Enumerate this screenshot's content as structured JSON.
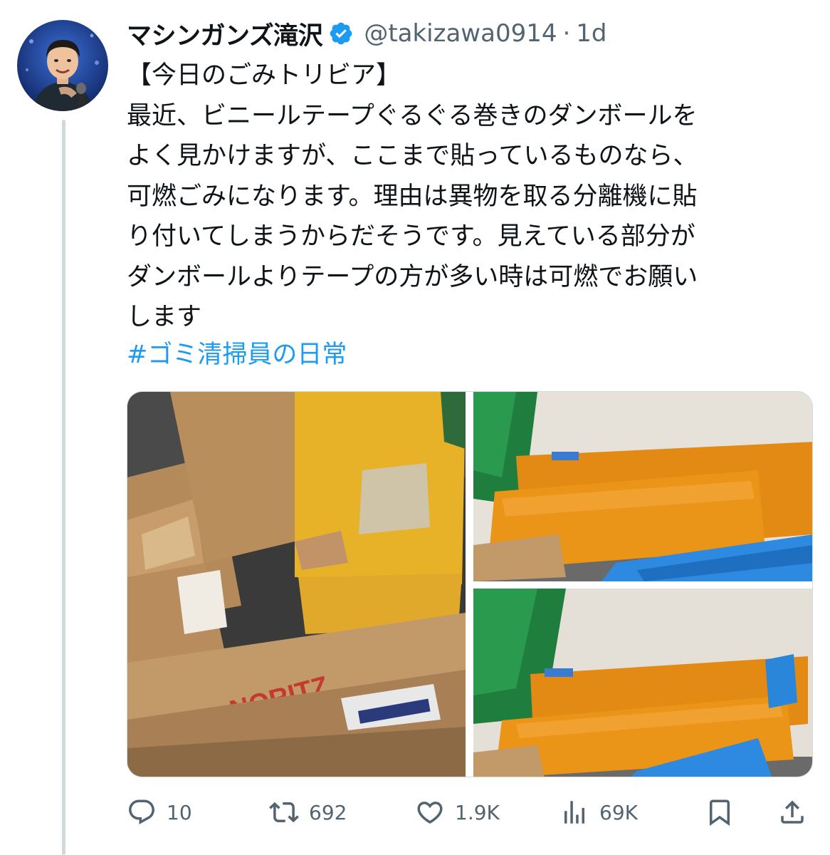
{
  "tweet": {
    "author": {
      "display_name": "マシンガンズ滝沢",
      "handle": "@takizawa0914",
      "separator": "·",
      "time": "1d",
      "verified": true,
      "verified_color": "#1d9bf0"
    },
    "text_lines": [
      "【今日のごみトリビア】",
      "最近、ビニールテープぐるぐる巻きのダンボールを",
      "よく見かけますが、ここまで貼っているものなら、",
      "可燃ごみになります。理由は異物を取る分離機に貼",
      "り付いてしまうからだそうです。見えている部分が",
      "ダンボールよりテープの方が多い時は可燃でお願い",
      "します"
    ],
    "hashtag": "#ゴミ清掃員の日常",
    "images": [
      {
        "alt": "Cardboard boxes wrapped in yellow tape with NORITZ box"
      },
      {
        "alt": "Cardboard wrapped in orange tape leaning on wall"
      },
      {
        "alt": "Cardboard wrapped in orange tape next to blue crate"
      }
    ],
    "image_text": {
      "brand": "NORITZ"
    },
    "actions": {
      "replies": "10",
      "retweets": "692",
      "likes": "1.9K",
      "views": "69K"
    },
    "icons": [
      "reply-icon",
      "retweet-icon",
      "like-icon",
      "views-icon",
      "bookmark-icon",
      "share-icon",
      "verified-badge-icon"
    ],
    "colors": {
      "link": "#1d9bf0",
      "secondary_text": "#536471",
      "primary_text": "#0f1419"
    }
  }
}
